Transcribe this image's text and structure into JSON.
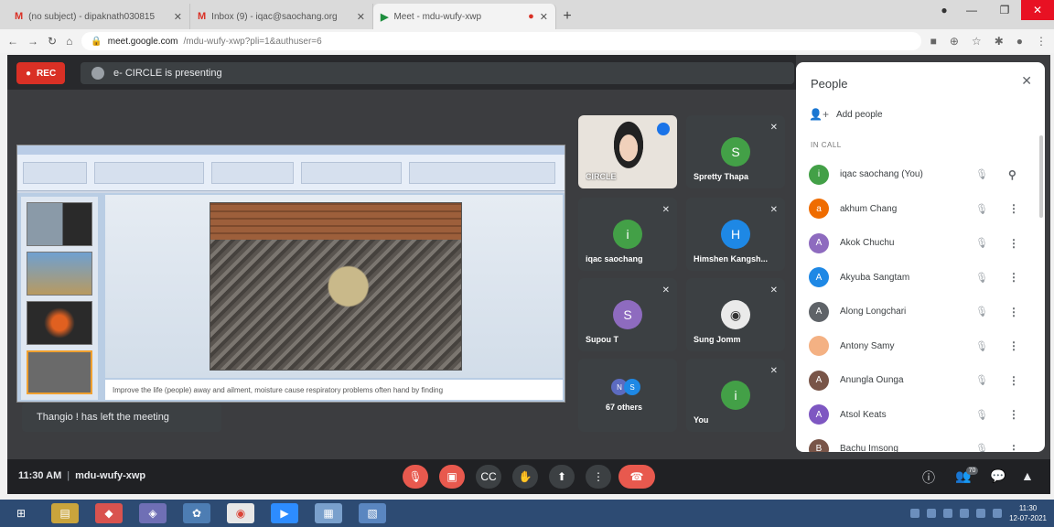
{
  "browser": {
    "tabs": [
      {
        "icon": "M",
        "title": "(no subject) - dipaknath030815",
        "close": "✕"
      },
      {
        "icon": "M",
        "title": "Inbox (9) - iqac@saochang.org",
        "close": "✕"
      },
      {
        "icon": "▶",
        "title": "Meet - mdu-wufy-xwp",
        "close": "✕"
      }
    ],
    "url_host": "meet.google.com",
    "url_path": "/mdu-wufy-xwp?pli=1&authuser=6"
  },
  "meet": {
    "rec_label": "REC",
    "presenting_text": "e- CIRCLE is presenting",
    "slide_caption": "Improve the life (people) away and ailment, moisture cause respiratory problems often hand by finding",
    "toast": "Thangio ! has left the meeting",
    "time": "11:30 AM",
    "meeting_code": "mdu-wufy-xwp",
    "participant_count": "70",
    "tiles": [
      {
        "name": "CIRCLE",
        "initial": "",
        "color": "#e8e3dc",
        "self": true
      },
      {
        "name": "Spretty Thapa",
        "initial": "S",
        "color": "#43a047"
      },
      {
        "name": "iqac saochang",
        "initial": "i",
        "color": "#43a047"
      },
      {
        "name": "Himshen Kangsh...",
        "initial": "H",
        "color": "#1e88e5"
      },
      {
        "name": "Supou T",
        "initial": "S",
        "color": "#8e6bbf"
      },
      {
        "name": "Sung Jomm",
        "initial": "",
        "color": "#3c4043"
      },
      {
        "name": "67 others",
        "initial": "",
        "color": "#3c4043"
      },
      {
        "name": "You",
        "initial": "i",
        "color": "#43a047"
      }
    ]
  },
  "panel": {
    "title": "People",
    "add_people": "Add people",
    "in_call": "IN CALL",
    "people": [
      {
        "name": "iqac saochang (You)",
        "initial": "i",
        "color": "#43a047"
      },
      {
        "name": "akhum Chang",
        "initial": "a",
        "color": "#ef6c00"
      },
      {
        "name": "Akok Chuchu",
        "initial": "A",
        "color": "#8e6bbf"
      },
      {
        "name": "Akyuba Sangtam",
        "initial": "A",
        "color": "#1e88e5"
      },
      {
        "name": "Along Longchari",
        "initial": "A",
        "color": "#5f6368"
      },
      {
        "name": "Antony Samy",
        "initial": "",
        "color": "#f4b183"
      },
      {
        "name": "Anungla Ounga",
        "initial": "A",
        "color": "#795548"
      },
      {
        "name": "Atsol Keats",
        "initial": "A",
        "color": "#7e57c2"
      },
      {
        "name": "Bachu Imsong",
        "initial": "B",
        "color": "#795548"
      }
    ]
  },
  "taskbar": {
    "time": "11:30",
    "date": "12-07-2021"
  }
}
